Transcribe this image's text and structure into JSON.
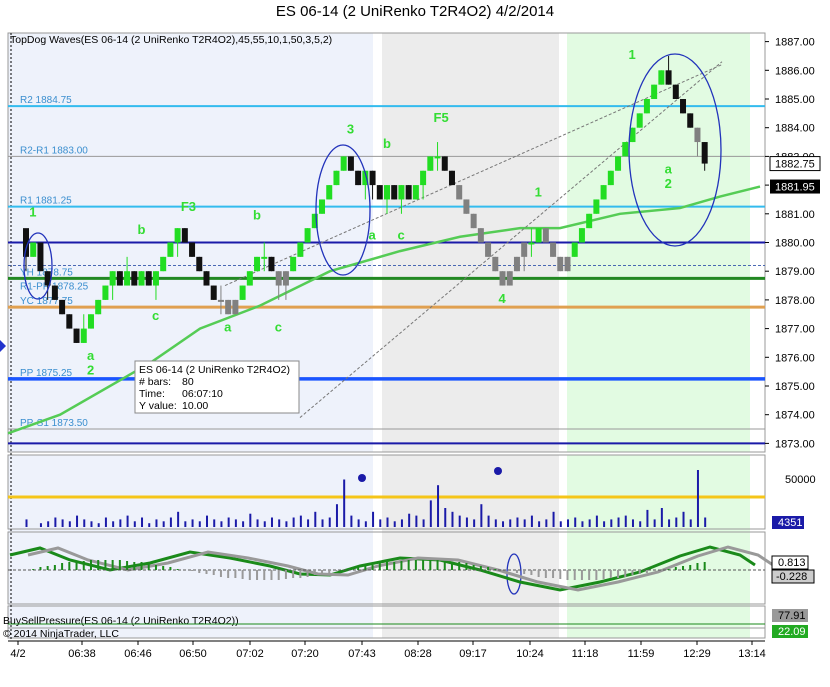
{
  "title": "ES 06-14 (2 UniRenko T2R4O2)  4/2/2014",
  "indicator_label": "TopDog Waves(ES 06-14 (2 UniRenko T2R4O2),45,55,10,1,50,3,5,2)",
  "pressure_label": "BuySellPressure(ES 06-14 (2 UniRenko T2R4O2))",
  "copyright": "© 2014 NinjaTrader, LLC",
  "colors": {
    "up_candle": "#22dd22",
    "down_candle": "#111111",
    "gray_candle": "#808080",
    "ma_line": "#55cc55",
    "pivot_line": "#33bbee",
    "level_line": "#1a1aa8",
    "green_line": "#228822",
    "orange_line": "#e0a050",
    "volume_bar": "#1a1aa8",
    "avg_volume_line": "#f5c518",
    "shade_gray": "#ececec",
    "shade_green": "#e2fbe2",
    "shade_blue": "#eef2fb",
    "label_green": "#33dd33"
  },
  "tooltip": {
    "name": "ES 06-14 (2 UniRenko T2R4O2)",
    "bars_label": "# bars:",
    "bars": "80",
    "time_label": "Time:",
    "time": "06:07:10",
    "y_label": "Y value:",
    "y": "10.00"
  },
  "price_labels": {
    "current": "1882.75",
    "ma_value": "1881.95",
    "volume_value": "4351",
    "osc_value1": "0.813",
    "osc_value2": "-0.228",
    "pressure_value1": "77.91",
    "pressure_value2": "22.09"
  },
  "chart_data": {
    "type": "candlestick",
    "title": "ES 06-14 (2 UniRenko T2R4O2)  4/2/2014",
    "y_ticks": [
      "1887.00",
      "1886.00",
      "1885.00",
      "1884.00",
      "1883.00",
      "1882.00",
      "1881.00",
      "1880.00",
      "1879.00",
      "1878.00",
      "1877.00",
      "1876.00",
      "1875.00",
      "1874.00",
      "1873.00"
    ],
    "ylim": [
      1872.7,
      1887.3
    ],
    "x_ticks": [
      "4/2",
      "06:38",
      "06:46",
      "06:50",
      "07:02",
      "07:20",
      "07:43",
      "08:28",
      "09:17",
      "10:24",
      "11:18",
      "11:59",
      "12:29",
      "13:14"
    ],
    "pivot_levels": [
      {
        "label": "R2 1884.75",
        "value": 1884.75
      },
      {
        "label": "R2-R1 1883.00",
        "value": 1883.0
      },
      {
        "label": "R1 1881.25",
        "value": 1881.25
      },
      {
        "label": "YH 1878.75",
        "value": 1878.75
      },
      {
        "label": "R1-PP 1878.25",
        "value": 1878.25
      },
      {
        "label": "YC 1877.75",
        "value": 1877.75
      },
      {
        "label": "PP 1875.25",
        "value": 1875.25
      },
      {
        "label": "PP-S1 1873.50",
        "value": 1873.5
      }
    ],
    "horizontal_lines": [
      1880.0,
      1873.0,
      1879.2,
      1878.75,
      1877.75
    ],
    "wave_labels": [
      {
        "text": "1",
        "bar": 1,
        "price": 1880.9
      },
      {
        "text": "a",
        "bar": 9,
        "price": 1875.9
      },
      {
        "text": "2",
        "bar": 9,
        "price": 1875.4
      },
      {
        "text": "F3",
        "bar": 22,
        "price": 1881.1
      },
      {
        "text": "b",
        "bar": 16,
        "price": 1880.3
      },
      {
        "text": "c",
        "bar": 18,
        "price": 1877.3
      },
      {
        "text": "a",
        "bar": 28,
        "price": 1876.9
      },
      {
        "text": "b",
        "bar": 32,
        "price": 1880.8
      },
      {
        "text": "c",
        "bar": 35,
        "price": 1876.9
      },
      {
        "text": "3",
        "bar": 45,
        "price": 1883.8
      },
      {
        "text": "b",
        "bar": 50,
        "price": 1883.3
      },
      {
        "text": "a",
        "bar": 48,
        "price": 1880.1
      },
      {
        "text": "c",
        "bar": 52,
        "price": 1880.1
      },
      {
        "text": "F5",
        "bar": 57,
        "price": 1884.2
      },
      {
        "text": "4",
        "bar": 66,
        "price": 1877.9
      },
      {
        "text": "1",
        "bar": 71,
        "price": 1881.6
      },
      {
        "text": "1",
        "bar": 84,
        "price": 1886.4
      },
      {
        "text": "a",
        "bar": 89,
        "price": 1882.4
      },
      {
        "text": "2",
        "bar": 89,
        "price": 1881.9
      }
    ],
    "series": [
      {
        "name": "price",
        "ohlc": [
          [
            1880.5,
            1879.0,
            1880.0,
            1879.5
          ],
          [
            1879.5,
            1879.5,
            1880.0,
            1880.0
          ],
          [
            1880.0,
            1879.0,
            1880.0,
            1879.0
          ],
          [
            1879.0,
            1878.0,
            1879.0,
            1878.5
          ],
          [
            1878.5,
            1878.0,
            1878.5,
            1878.0
          ],
          [
            1878.0,
            1877.5,
            1878.0,
            1877.5
          ],
          [
            1877.5,
            1877.0,
            1877.5,
            1877.0
          ],
          [
            1877.0,
            1876.5,
            1877.0,
            1876.5
          ],
          [
            1876.5,
            1876.5,
            1877.5,
            1877.0
          ],
          [
            1877.0,
            1877.0,
            1877.5,
            1877.5
          ],
          [
            1877.5,
            1877.5,
            1878.0,
            1878.0
          ],
          [
            1878.0,
            1878.0,
            1878.5,
            1878.5
          ],
          [
            1878.5,
            1878.0,
            1879.0,
            1879.0
          ],
          [
            1879.0,
            1878.5,
            1879.0,
            1878.5
          ],
          [
            1878.5,
            1878.5,
            1879.5,
            1879.0
          ],
          [
            1879.0,
            1878.5,
            1879.0,
            1878.5
          ],
          [
            1878.5,
            1878.5,
            1879.0,
            1879.0
          ],
          [
            1879.0,
            1878.5,
            1879.0,
            1878.5
          ],
          [
            1878.5,
            1878.0,
            1879.0,
            1879.0
          ],
          [
            1879.0,
            1879.0,
            1879.5,
            1879.5
          ],
          [
            1879.5,
            1879.5,
            1880.0,
            1880.0
          ],
          [
            1880.0,
            1879.5,
            1880.5,
            1880.5
          ],
          [
            1880.5,
            1880.0,
            1880.5,
            1880.0
          ],
          [
            1880.0,
            1879.5,
            1880.0,
            1879.5
          ],
          [
            1879.5,
            1879.0,
            1879.5,
            1879.0
          ],
          [
            1879.0,
            1878.5,
            1879.0,
            1878.5
          ],
          [
            1878.5,
            1878.0,
            1878.5,
            1878.0
          ],
          [
            1878.0,
            1877.5,
            1878.5,
            1878.0
          ],
          [
            1878.0,
            1877.5,
            1878.0,
            1877.5
          ],
          [
            1877.5,
            1877.5,
            1878.0,
            1878.0
          ],
          [
            1878.0,
            1878.0,
            1878.5,
            1878.5
          ],
          [
            1878.5,
            1878.5,
            1879.0,
            1879.0
          ],
          [
            1879.0,
            1879.0,
            1879.5,
            1879.5
          ],
          [
            1879.5,
            1879.0,
            1880.0,
            1879.5
          ],
          [
            1879.5,
            1879.0,
            1879.5,
            1879.0
          ],
          [
            1879.0,
            1878.0,
            1879.0,
            1878.5
          ],
          [
            1878.5,
            1878.0,
            1879.0,
            1879.0
          ],
          [
            1879.0,
            1879.0,
            1879.5,
            1879.5
          ],
          [
            1879.5,
            1879.5,
            1880.0,
            1880.0
          ],
          [
            1880.0,
            1880.0,
            1880.5,
            1880.5
          ],
          [
            1880.5,
            1880.5,
            1881.0,
            1881.0
          ],
          [
            1881.0,
            1881.0,
            1881.5,
            1881.5
          ],
          [
            1881.5,
            1881.5,
            1882.0,
            1882.0
          ],
          [
            1882.0,
            1882.0,
            1882.5,
            1882.5
          ],
          [
            1882.5,
            1882.5,
            1883.0,
            1883.0
          ],
          [
            1883.0,
            1882.5,
            1883.0,
            1882.5
          ],
          [
            1882.5,
            1882.0,
            1882.5,
            1882.0
          ],
          [
            1882.0,
            1881.5,
            1882.5,
            1882.5
          ],
          [
            1882.5,
            1881.5,
            1882.5,
            1882.0
          ],
          [
            1882.0,
            1881.5,
            1882.0,
            1881.5
          ],
          [
            1881.5,
            1881.0,
            1882.0,
            1882.0
          ],
          [
            1882.0,
            1881.5,
            1882.0,
            1881.5
          ],
          [
            1881.5,
            1881.0,
            1882.0,
            1882.0
          ],
          [
            1882.0,
            1881.5,
            1882.0,
            1881.5
          ],
          [
            1881.5,
            1881.5,
            1882.0,
            1882.0
          ],
          [
            1882.0,
            1881.5,
            1882.5,
            1882.5
          ],
          [
            1882.5,
            1882.5,
            1883.0,
            1883.0
          ],
          [
            1883.0,
            1882.5,
            1883.5,
            1883.0
          ],
          [
            1883.0,
            1882.5,
            1883.0,
            1882.5
          ],
          [
            1882.5,
            1882.0,
            1882.5,
            1882.0
          ],
          [
            1882.0,
            1881.5,
            1882.0,
            1881.5
          ],
          [
            1881.5,
            1881.0,
            1881.5,
            1881.0
          ],
          [
            1881.0,
            1880.5,
            1881.0,
            1880.5
          ],
          [
            1880.5,
            1880.0,
            1880.5,
            1880.0
          ],
          [
            1880.0,
            1879.5,
            1880.0,
            1879.5
          ],
          [
            1879.5,
            1879.0,
            1879.5,
            1879.0
          ],
          [
            1879.0,
            1878.5,
            1879.0,
            1878.5
          ],
          [
            1878.5,
            1878.5,
            1879.0,
            1879.0
          ],
          [
            1879.0,
            1879.0,
            1879.5,
            1879.5
          ],
          [
            1879.5,
            1879.0,
            1880.0,
            1880.0
          ],
          [
            1880.0,
            1879.5,
            1880.5,
            1880.0
          ],
          [
            1880.0,
            1880.0,
            1880.5,
            1880.5
          ],
          [
            1880.5,
            1880.0,
            1880.5,
            1880.0
          ],
          [
            1880.0,
            1879.5,
            1880.0,
            1879.5
          ],
          [
            1879.5,
            1879.0,
            1879.5,
            1879.0
          ],
          [
            1879.0,
            1879.0,
            1879.5,
            1879.5
          ],
          [
            1879.5,
            1879.5,
            1880.0,
            1880.0
          ],
          [
            1880.0,
            1880.0,
            1880.5,
            1880.5
          ],
          [
            1880.5,
            1880.5,
            1881.0,
            1881.0
          ],
          [
            1881.0,
            1881.0,
            1881.5,
            1881.5
          ],
          [
            1881.5,
            1881.5,
            1882.0,
            1882.0
          ],
          [
            1882.0,
            1882.0,
            1882.5,
            1882.5
          ],
          [
            1882.5,
            1882.5,
            1883.0,
            1883.0
          ],
          [
            1883.0,
            1883.0,
            1883.5,
            1883.5
          ],
          [
            1883.5,
            1883.5,
            1884.0,
            1884.0
          ],
          [
            1884.0,
            1884.0,
            1884.5,
            1884.5
          ],
          [
            1884.5,
            1884.5,
            1885.0,
            1885.0
          ],
          [
            1885.0,
            1885.0,
            1885.5,
            1885.5
          ],
          [
            1885.5,
            1885.5,
            1886.0,
            1886.0
          ],
          [
            1886.0,
            1885.5,
            1886.5,
            1885.5
          ],
          [
            1885.5,
            1885.0,
            1885.5,
            1885.0
          ],
          [
            1885.0,
            1884.5,
            1885.0,
            1884.5
          ],
          [
            1884.5,
            1884.0,
            1884.5,
            1884.0
          ],
          [
            1884.0,
            1883.0,
            1884.0,
            1883.5
          ],
          [
            1883.5,
            1882.5,
            1883.5,
            1882.75
          ]
        ]
      }
    ]
  }
}
